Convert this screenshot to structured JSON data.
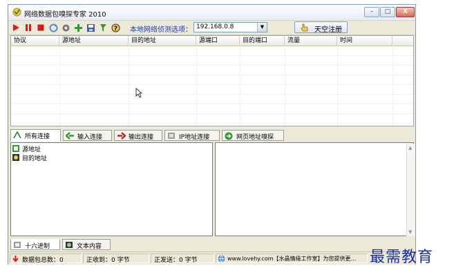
{
  "window": {
    "title": "网络数据包嗅探专家 2010",
    "controls": {
      "minimize": "–",
      "maximize": "□",
      "close": "X"
    }
  },
  "toolbar": {
    "icons": [
      "play-icon",
      "pause-icon",
      "stop-icon",
      "refresh-icon",
      "settings-icon",
      "add-icon",
      "save-icon",
      "filter-icon",
      "help-icon"
    ],
    "network_label": "本地网络侦测选项：",
    "network_value": "192.168.0.8",
    "register_label": "天空注册"
  },
  "grid": {
    "columns": [
      "协议",
      "源地址",
      "目的地址",
      "源端口",
      "目的端口",
      "流量",
      "时间"
    ],
    "rows": []
  },
  "conn_tabs": [
    {
      "label": "所有连接",
      "icon": "all-connections-icon",
      "active": true
    },
    {
      "label": "输入连接",
      "icon": "incoming-arrow-icon"
    },
    {
      "label": "输出连接",
      "icon": "outgoing-arrow-icon"
    },
    {
      "label": "IP地址连接",
      "icon": "ip-address-icon"
    },
    {
      "label": "网页地址嗅探",
      "icon": "web-sniff-icon"
    }
  ],
  "tree": {
    "items": [
      {
        "label": "源地址",
        "icon": "source-icon"
      },
      {
        "label": "目的地址",
        "icon": "destination-icon"
      }
    ]
  },
  "bottom_tabs": [
    {
      "label": "十六进制",
      "icon": "hex-icon",
      "active": true
    },
    {
      "label": "文本内容",
      "icon": "text-icon"
    }
  ],
  "status": {
    "packets": "数据包总数：0",
    "received": "正收到：0 字节",
    "sent": "正发送：0 字节",
    "credit": "www.lovehy.com【水晶情缘工作室】为您提供更…"
  },
  "watermark": "最需教育",
  "colors": {
    "accent_blue": "#1b3db0",
    "watermark": "#1a2ea8"
  }
}
